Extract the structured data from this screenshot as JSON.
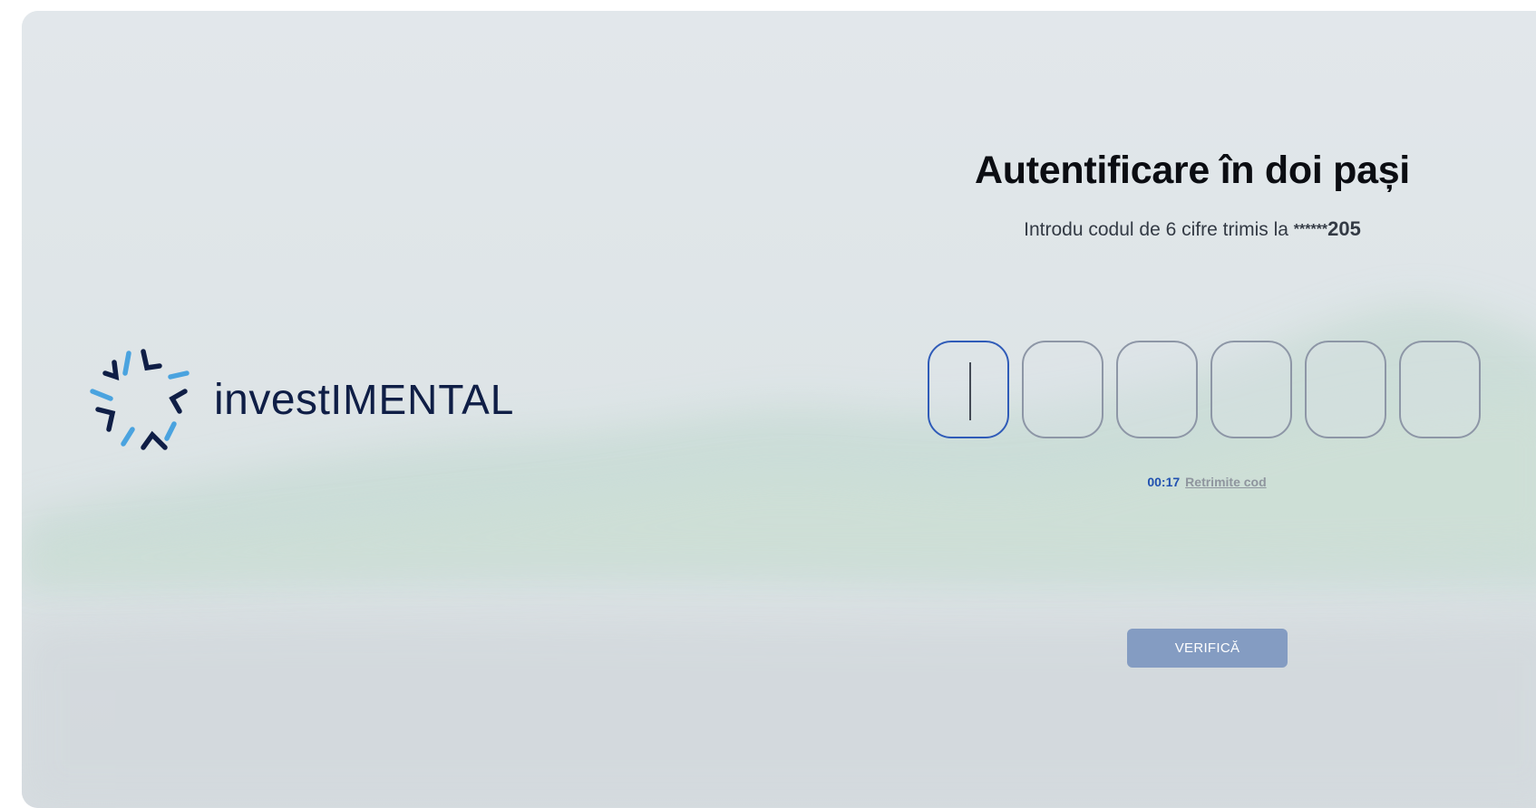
{
  "brand": {
    "name_lower": "inves",
    "name_t": "t",
    "name_upper": "IMENTAL",
    "logo_icon": "star-burst-logo-icon",
    "colors": {
      "navy": "#0f1e46",
      "light_blue": "#4aa3df"
    }
  },
  "auth": {
    "title": "Autentificare în doi pași",
    "subtitle_prefix": "Introdu codul de 6 cifre trimis la ",
    "masked": "******",
    "phone_suffix": "205",
    "otp_digits": [
      "",
      "",
      "",
      "",
      "",
      ""
    ],
    "timer": "00:17",
    "resend_label": "Retrimite cod",
    "verify_label": "VERIFICĂ"
  },
  "colors": {
    "accent": "#2f5bb8",
    "button_disabled": "#849cc2",
    "background": "#e1e6ea"
  }
}
